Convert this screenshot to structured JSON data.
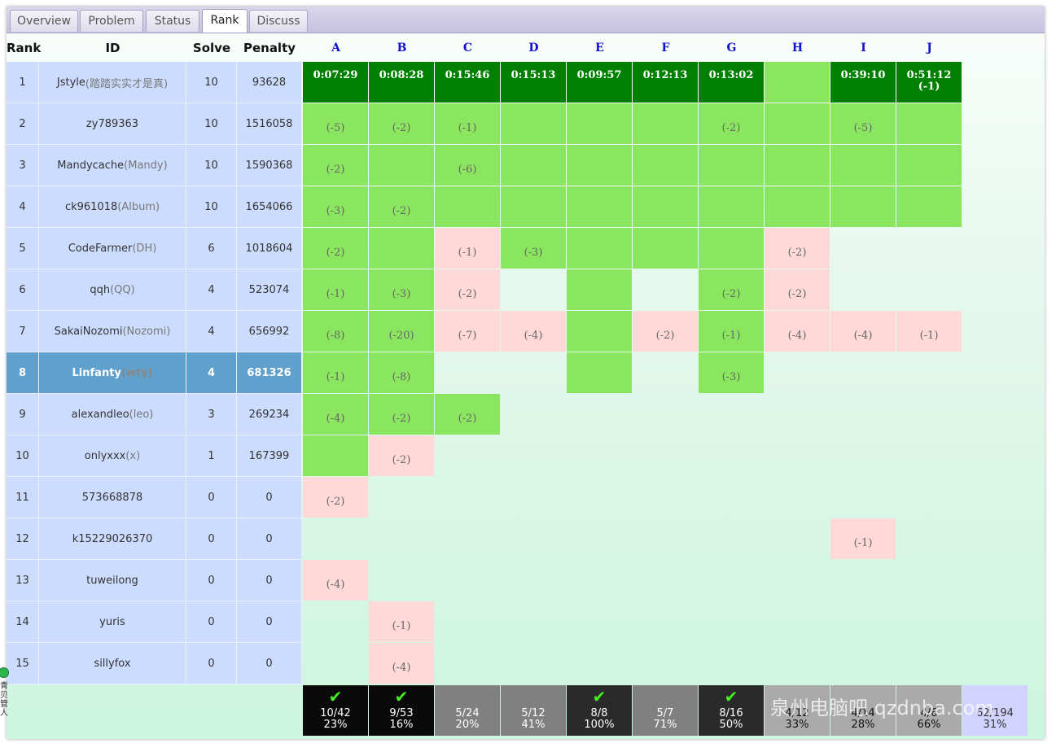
{
  "tabs": [
    "Overview",
    "Problem",
    "Status",
    "Rank",
    "Discuss"
  ],
  "active_tab": "Rank",
  "headers": {
    "rank": "Rank",
    "id": "ID",
    "solve": "Solve",
    "penalty": "Penalty"
  },
  "problems": [
    "A",
    "B",
    "C",
    "D",
    "E",
    "F",
    "G",
    "H",
    "I",
    "J"
  ],
  "colors": {
    "first_blood": "#008000",
    "accepted": "#8be65f",
    "wrong": "#ffd8d8",
    "row_bg": "#ccdcff",
    "selected_row": "#5fa0cc"
  },
  "rows": [
    {
      "rank": "1",
      "id": "Jstyle",
      "nick": "(踏踏实实才是真)",
      "solve": "10",
      "penalty": "93628",
      "cells": [
        {
          "s": "fb",
          "t": "0:07:29"
        },
        {
          "s": "fb",
          "t": "0:08:28"
        },
        {
          "s": "fb",
          "t": "0:15:46"
        },
        {
          "s": "fb",
          "t": "0:15:13"
        },
        {
          "s": "fb",
          "t": "0:09:57"
        },
        {
          "s": "fb",
          "t": "0:12:13"
        },
        {
          "s": "fb",
          "t": "0:13:02"
        },
        {
          "s": "ac",
          "t": ""
        },
        {
          "s": "fb",
          "t": "0:39:10"
        },
        {
          "s": "fb",
          "t": "0:51:12",
          "t2": "(-1)"
        }
      ]
    },
    {
      "rank": "2",
      "id": "zy789363",
      "nick": "",
      "solve": "10",
      "penalty": "1516058",
      "cells": [
        {
          "s": "ac",
          "t": "(-5)"
        },
        {
          "s": "ac",
          "t": "(-2)"
        },
        {
          "s": "ac",
          "t": "(-1)"
        },
        {
          "s": "ac",
          "t": ""
        },
        {
          "s": "ac",
          "t": ""
        },
        {
          "s": "ac",
          "t": ""
        },
        {
          "s": "ac",
          "t": "(-2)"
        },
        {
          "s": "ac",
          "t": ""
        },
        {
          "s": "ac",
          "t": "(-5)"
        },
        {
          "s": "ac",
          "t": ""
        }
      ]
    },
    {
      "rank": "3",
      "id": "Mandycache",
      "nick": "(Mandy)",
      "solve": "10",
      "penalty": "1590368",
      "cells": [
        {
          "s": "ac",
          "t": "(-2)"
        },
        {
          "s": "ac",
          "t": ""
        },
        {
          "s": "ac",
          "t": "(-6)"
        },
        {
          "s": "ac",
          "t": ""
        },
        {
          "s": "ac",
          "t": ""
        },
        {
          "s": "ac",
          "t": ""
        },
        {
          "s": "ac",
          "t": ""
        },
        {
          "s": "ac",
          "t": ""
        },
        {
          "s": "ac",
          "t": ""
        },
        {
          "s": "ac",
          "t": ""
        }
      ]
    },
    {
      "rank": "4",
      "id": "ck961018",
      "nick": "(Album)",
      "solve": "10",
      "penalty": "1654066",
      "cells": [
        {
          "s": "ac",
          "t": "(-3)"
        },
        {
          "s": "ac",
          "t": "(-2)"
        },
        {
          "s": "ac",
          "t": ""
        },
        {
          "s": "ac",
          "t": ""
        },
        {
          "s": "ac",
          "t": ""
        },
        {
          "s": "ac",
          "t": ""
        },
        {
          "s": "ac",
          "t": ""
        },
        {
          "s": "ac",
          "t": ""
        },
        {
          "s": "ac",
          "t": ""
        },
        {
          "s": "ac",
          "t": ""
        }
      ]
    },
    {
      "rank": "5",
      "id": "CodeFarmer",
      "nick": "(DH)",
      "solve": "6",
      "penalty": "1018604",
      "cells": [
        {
          "s": "ac",
          "t": "(-2)"
        },
        {
          "s": "ac",
          "t": ""
        },
        {
          "s": "wa",
          "t": "(-1)"
        },
        {
          "s": "ac",
          "t": "(-3)"
        },
        {
          "s": "ac",
          "t": ""
        },
        {
          "s": "ac",
          "t": ""
        },
        {
          "s": "ac",
          "t": ""
        },
        {
          "s": "wa",
          "t": "(-2)"
        },
        {
          "s": "",
          "t": ""
        },
        {
          "s": "",
          "t": ""
        }
      ]
    },
    {
      "rank": "6",
      "id": "qqh",
      "nick": "(QQ)",
      "solve": "4",
      "penalty": "523074",
      "cells": [
        {
          "s": "ac",
          "t": "(-1)"
        },
        {
          "s": "ac",
          "t": "(-3)"
        },
        {
          "s": "wa",
          "t": "(-2)"
        },
        {
          "s": "",
          "t": ""
        },
        {
          "s": "ac",
          "t": ""
        },
        {
          "s": "",
          "t": ""
        },
        {
          "s": "ac",
          "t": "(-2)"
        },
        {
          "s": "wa",
          "t": "(-2)"
        },
        {
          "s": "",
          "t": ""
        },
        {
          "s": "",
          "t": ""
        }
      ]
    },
    {
      "rank": "7",
      "id": "SakaiNozomi",
      "nick": "(Nozomi)",
      "solve": "4",
      "penalty": "656992",
      "cells": [
        {
          "s": "ac",
          "t": "(-8)"
        },
        {
          "s": "ac",
          "t": "(-20)"
        },
        {
          "s": "wa",
          "t": "(-7)"
        },
        {
          "s": "wa",
          "t": "(-4)"
        },
        {
          "s": "ac",
          "t": ""
        },
        {
          "s": "wa",
          "t": "(-2)"
        },
        {
          "s": "ac",
          "t": "(-1)"
        },
        {
          "s": "wa",
          "t": "(-4)"
        },
        {
          "s": "wa",
          "t": "(-4)"
        },
        {
          "s": "wa",
          "t": "(-1)"
        }
      ]
    },
    {
      "rank": "8",
      "id": "Linfanty",
      "nick": "(wty)",
      "solve": "4",
      "penalty": "681326",
      "selected": true,
      "cells": [
        {
          "s": "ac",
          "t": "(-1)"
        },
        {
          "s": "ac",
          "t": "(-8)"
        },
        {
          "s": "",
          "t": ""
        },
        {
          "s": "",
          "t": ""
        },
        {
          "s": "ac",
          "t": ""
        },
        {
          "s": "",
          "t": ""
        },
        {
          "s": "ac",
          "t": "(-3)"
        },
        {
          "s": "",
          "t": ""
        },
        {
          "s": "",
          "t": ""
        },
        {
          "s": "",
          "t": ""
        }
      ]
    },
    {
      "rank": "9",
      "id": "alexandleo",
      "nick": "(leo)",
      "solve": "3",
      "penalty": "269234",
      "cells": [
        {
          "s": "ac",
          "t": "(-4)"
        },
        {
          "s": "ac",
          "t": "(-2)"
        },
        {
          "s": "ac",
          "t": "(-2)"
        },
        {
          "s": "",
          "t": ""
        },
        {
          "s": "",
          "t": ""
        },
        {
          "s": "",
          "t": ""
        },
        {
          "s": "",
          "t": ""
        },
        {
          "s": "",
          "t": ""
        },
        {
          "s": "",
          "t": ""
        },
        {
          "s": "",
          "t": ""
        }
      ]
    },
    {
      "rank": "10",
      "id": "onlyxxx",
      "nick": "(x)",
      "solve": "1",
      "penalty": "167399",
      "cells": [
        {
          "s": "ac",
          "t": ""
        },
        {
          "s": "wa",
          "t": "(-2)"
        },
        {
          "s": "",
          "t": ""
        },
        {
          "s": "",
          "t": ""
        },
        {
          "s": "",
          "t": ""
        },
        {
          "s": "",
          "t": ""
        },
        {
          "s": "",
          "t": ""
        },
        {
          "s": "",
          "t": ""
        },
        {
          "s": "",
          "t": ""
        },
        {
          "s": "",
          "t": ""
        }
      ]
    },
    {
      "rank": "11",
      "id": "573668878",
      "nick": "",
      "solve": "0",
      "penalty": "0",
      "cells": [
        {
          "s": "wa",
          "t": "(-2)"
        },
        {
          "s": "",
          "t": ""
        },
        {
          "s": "",
          "t": ""
        },
        {
          "s": "",
          "t": ""
        },
        {
          "s": "",
          "t": ""
        },
        {
          "s": "",
          "t": ""
        },
        {
          "s": "",
          "t": ""
        },
        {
          "s": "",
          "t": ""
        },
        {
          "s": "",
          "t": ""
        },
        {
          "s": "",
          "t": ""
        }
      ]
    },
    {
      "rank": "12",
      "id": "k15229026370",
      "nick": "",
      "solve": "0",
      "penalty": "0",
      "cells": [
        {
          "s": "",
          "t": ""
        },
        {
          "s": "",
          "t": ""
        },
        {
          "s": "",
          "t": ""
        },
        {
          "s": "",
          "t": ""
        },
        {
          "s": "",
          "t": ""
        },
        {
          "s": "",
          "t": ""
        },
        {
          "s": "",
          "t": ""
        },
        {
          "s": "",
          "t": ""
        },
        {
          "s": "wa",
          "t": "(-1)"
        },
        {
          "s": "",
          "t": ""
        }
      ]
    },
    {
      "rank": "13",
      "id": "tuweilong",
      "nick": "",
      "solve": "0",
      "penalty": "0",
      "cells": [
        {
          "s": "wa",
          "t": "(-4)"
        },
        {
          "s": "",
          "t": ""
        },
        {
          "s": "",
          "t": ""
        },
        {
          "s": "",
          "t": ""
        },
        {
          "s": "",
          "t": ""
        },
        {
          "s": "",
          "t": ""
        },
        {
          "s": "",
          "t": ""
        },
        {
          "s": "",
          "t": ""
        },
        {
          "s": "",
          "t": ""
        },
        {
          "s": "",
          "t": ""
        }
      ]
    },
    {
      "rank": "14",
      "id": "yuris",
      "nick": "",
      "solve": "0",
      "penalty": "0",
      "cells": [
        {
          "s": "",
          "t": ""
        },
        {
          "s": "wa",
          "t": "(-1)"
        },
        {
          "s": "",
          "t": ""
        },
        {
          "s": "",
          "t": ""
        },
        {
          "s": "",
          "t": ""
        },
        {
          "s": "",
          "t": ""
        },
        {
          "s": "",
          "t": ""
        },
        {
          "s": "",
          "t": ""
        },
        {
          "s": "",
          "t": ""
        },
        {
          "s": "",
          "t": ""
        }
      ]
    },
    {
      "rank": "15",
      "id": "sillyfox",
      "nick": "",
      "solve": "0",
      "penalty": "0",
      "cells": [
        {
          "s": "",
          "t": ""
        },
        {
          "s": "wa",
          "t": "(-4)"
        },
        {
          "s": "",
          "t": ""
        },
        {
          "s": "",
          "t": ""
        },
        {
          "s": "",
          "t": ""
        },
        {
          "s": "",
          "t": ""
        },
        {
          "s": "",
          "t": ""
        },
        {
          "s": "",
          "t": ""
        },
        {
          "s": "",
          "t": ""
        },
        {
          "s": "",
          "t": ""
        }
      ]
    }
  ],
  "stats": [
    {
      "frac": "10/42",
      "pct": "23%",
      "style": "best",
      "check": true
    },
    {
      "frac": "9/53",
      "pct": "16%",
      "style": "best",
      "check": true
    },
    {
      "frac": "5/24",
      "pct": "20%",
      "style": "grey",
      "check": false
    },
    {
      "frac": "5/12",
      "pct": "41%",
      "style": "grey",
      "check": false
    },
    {
      "frac": "8/8",
      "pct": "100%",
      "style": "solved",
      "check": true
    },
    {
      "frac": "5/7",
      "pct": "71%",
      "style": "grey",
      "check": false
    },
    {
      "frac": "8/16",
      "pct": "50%",
      "style": "solved",
      "check": true
    },
    {
      "frac": "4/12",
      "pct": "33%",
      "style": "light",
      "check": false
    },
    {
      "frac": "4/14",
      "pct": "28%",
      "style": "light",
      "check": false
    },
    {
      "frac": "4/6",
      "pct": "66%",
      "style": "light",
      "check": false
    }
  ],
  "total": {
    "frac": "62/194",
    "pct": "31%"
  },
  "check_glyph": "✔",
  "watermark": "泉州电脑吧 qzdnba.com",
  "side_widget_text": "青 贝 管 人"
}
